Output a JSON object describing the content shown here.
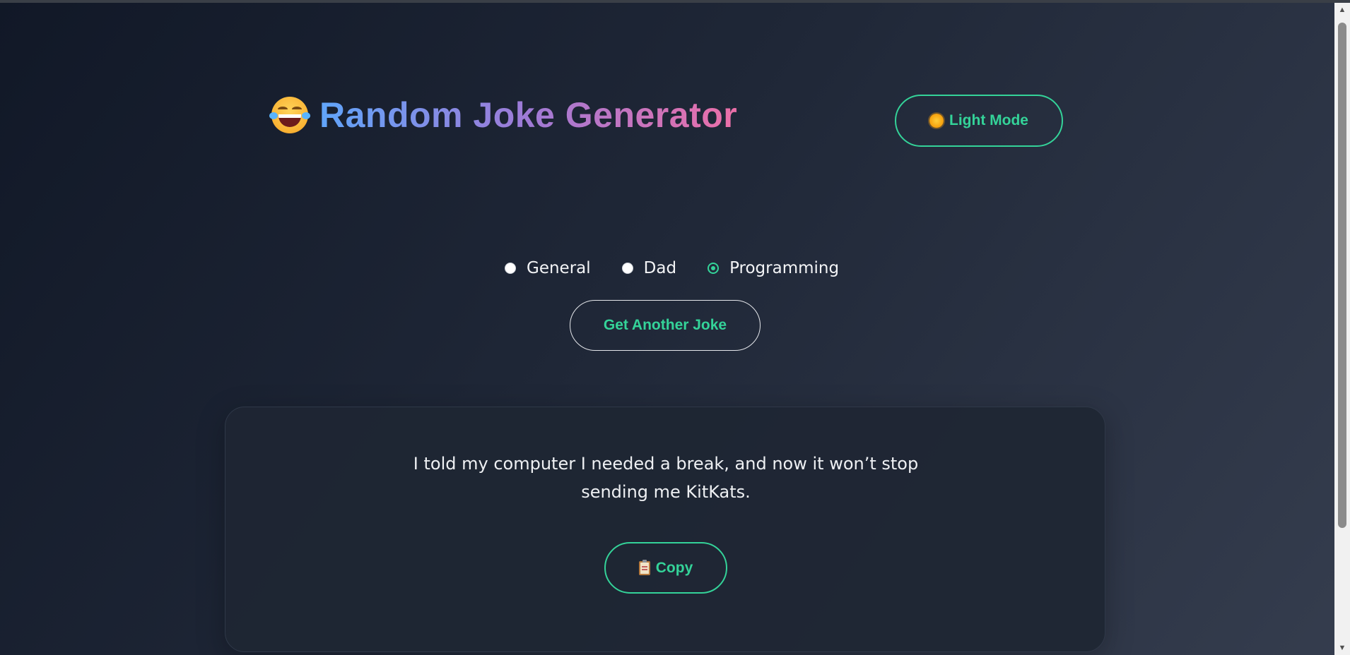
{
  "header": {
    "title": "Random Joke Generator",
    "title_icon": "rolling-laughing-face-icon",
    "theme_toggle_label": "Light Mode",
    "theme_toggle_icon": "sun-icon"
  },
  "categories": {
    "options": [
      {
        "label": "General",
        "checked": false
      },
      {
        "label": "Dad",
        "checked": false
      },
      {
        "label": "Programming",
        "checked": true
      }
    ]
  },
  "actions": {
    "get_joke_label": "Get Another Joke"
  },
  "joke_card": {
    "joke_line1": "I told my computer I needed a break, and now it won’t stop",
    "joke_line2": "sending me KitKats.",
    "copy_label": "Copy",
    "copy_icon": "clipboard-icon"
  },
  "colors": {
    "accent": "#34d399",
    "title_gradient_start": "#60a5fa",
    "title_gradient_end": "#ec6fa8",
    "background_dark": "#111827"
  }
}
